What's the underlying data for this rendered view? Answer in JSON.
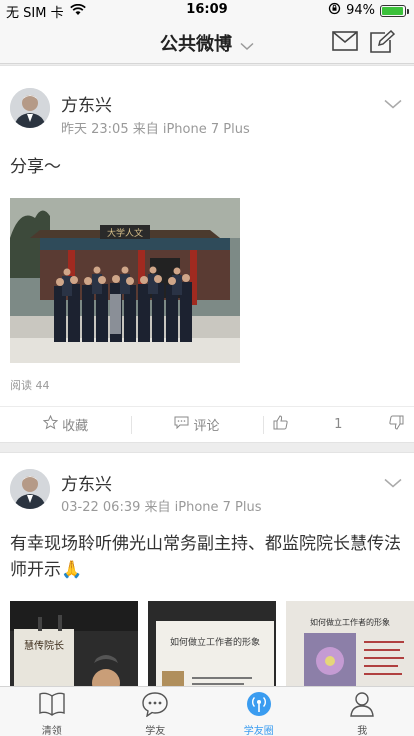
{
  "status": {
    "carrier": "无 SIM 卡",
    "time": "16:09",
    "battery": "94%",
    "battery_level": 0.94
  },
  "nav": {
    "title": "公共微博"
  },
  "posts": [
    {
      "author": "方东兴",
      "meta": "昨天 23:05  来自 iPhone 7 Plus",
      "text": "分享～",
      "read_count": "阅读 44",
      "actions": {
        "favorite": "收藏",
        "comment": "评论",
        "like_count": "1"
      },
      "image_caption_sign": "大学人文"
    },
    {
      "author": "方东兴",
      "meta": "03-22 06:39  来自 iPhone 7 Plus",
      "text": "有幸现场聆听佛光山常务副主持、都监院院长慧传法师开示🙏",
      "thumbs": [
        {
          "sign": "慧传院长"
        },
        {
          "headline": "如何做立工作者的形象"
        },
        {
          "headline": "如何做立工作者的形象"
        }
      ]
    }
  ],
  "tabs": [
    {
      "label": "清领",
      "icon": "book-icon"
    },
    {
      "label": "学友",
      "icon": "chat-bubble-icon"
    },
    {
      "label": "学友圈",
      "icon": "broadcast-icon"
    },
    {
      "label": "我",
      "icon": "person-icon"
    }
  ],
  "colors": {
    "accent": "#3a9cf0",
    "battery": "#3cc13b"
  }
}
